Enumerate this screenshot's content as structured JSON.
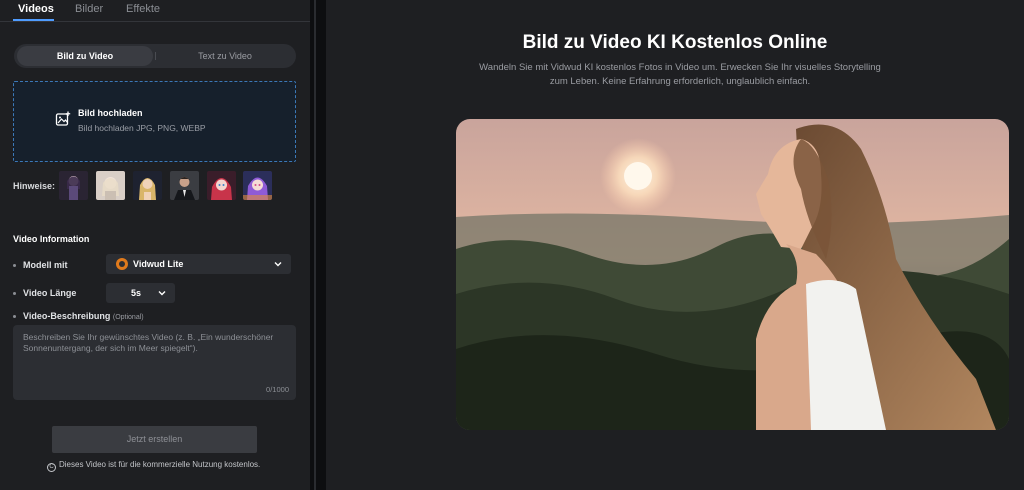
{
  "tabs": [
    {
      "label": "Videos",
      "active": true
    },
    {
      "label": "Bilder",
      "active": false
    },
    {
      "label": "Effekte",
      "active": false
    }
  ],
  "mode": {
    "image_to_video": "Bild zu Video",
    "text_to_video": "Text zu Video",
    "active": "image_to_video"
  },
  "upload": {
    "title": "Bild hochladen",
    "subtitle": "Bild hochladen JPG, PNG, WEBP"
  },
  "hints": {
    "label": "Hinweise:",
    "thumbnails": [
      "anime-girl-purple",
      "pastel-girl",
      "blonde-woman",
      "man-in-suit",
      "anime-girl-red-hair",
      "anime-girl-purple-hair"
    ]
  },
  "video_info": {
    "title": "Video Information",
    "model_label": "Modell mit",
    "model_value": "Vidwud Lite",
    "length_label": "Video Länge",
    "length_value": "5s",
    "description_label": "Video-Beschreibung",
    "description_optional": "(Optional)",
    "description_placeholder": "Beschreiben Sie Ihr gewünschtes Video (z. B. „Ein wunderschöner Sonnenuntergang, der sich im Meer spiegelt“).",
    "char_count": "0/1000"
  },
  "actions": {
    "create_label": "Jetzt erstellen",
    "footnote": "Dieses Video ist für die kommerzielle Nutzung kostenlos.",
    "footnote_icon": "copyright-icon"
  },
  "hero": {
    "title": "Bild zu Video KI Kostenlos Online",
    "subtitle": "Wandeln Sie mit Vidwud KI kostenlos Fotos in Video um. Erwecken Sie Ihr visuelles Storytelling zum Leben. Keine Erfahrung erforderlich, unglaublich einfach."
  },
  "colors": {
    "accent": "#4f9cff",
    "background": "#1e1f22",
    "panel": "#2c2e33",
    "upload_border": "#3b78b8",
    "model_logo": "#e07a1c"
  }
}
